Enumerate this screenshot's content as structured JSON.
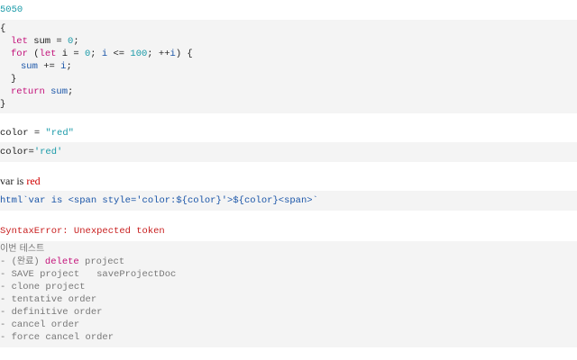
{
  "output_5050": "5050",
  "code_block": {
    "l1": "{",
    "l2_let": "let",
    "l2_rest_a": " sum = ",
    "l2_zero": "0",
    "l2_semi": ";",
    "l3_for": "for",
    "l3_p1": " (",
    "l3_let": "let",
    "l3_i": " i = ",
    "l3_zero": "0",
    "l3_semi1": "; ",
    "l3_i2": "i",
    "l3_le": " <= ",
    "l3_100": "100",
    "l3_semi2": "; ++",
    "l3_i3": "i",
    "l3_end": ") {",
    "l4_sum": "sum",
    "l4_pe": " += ",
    "l4_i": "i",
    "l4_semi": ";",
    "l5": "}",
    "l6_return": "return",
    "l6_sp": " ",
    "l6_sum": "sum",
    "l6_semi": ";",
    "l7": "}"
  },
  "color_assign": {
    "name": "color",
    "eq": " = ",
    "value": "\"red\""
  },
  "color_attr": {
    "name": "color",
    "eq": "=",
    "value": "'red'"
  },
  "var_line": {
    "prefix": "var is ",
    "word": "red"
  },
  "html_line": {
    "tag": "html",
    "text": "`var is <span style='color:${color}'>${color}<span>`"
  },
  "syntax_error": "SyntaxError: Unexpected token",
  "test_block": {
    "title": "이번 테스트",
    "items": [
      {
        "prefix": "- (",
        "tag": "완료",
        "mid": ") ",
        "keyword": "delete",
        "rest": " project"
      },
      {
        "prefix": "- SAVE project   saveProjectDoc"
      },
      {
        "prefix": "- clone project"
      },
      {
        "prefix": "- tentative order"
      },
      {
        "prefix": "- definitive order"
      },
      {
        "prefix": "- cancel order"
      },
      {
        "prefix": "- force cancel order"
      }
    ]
  }
}
